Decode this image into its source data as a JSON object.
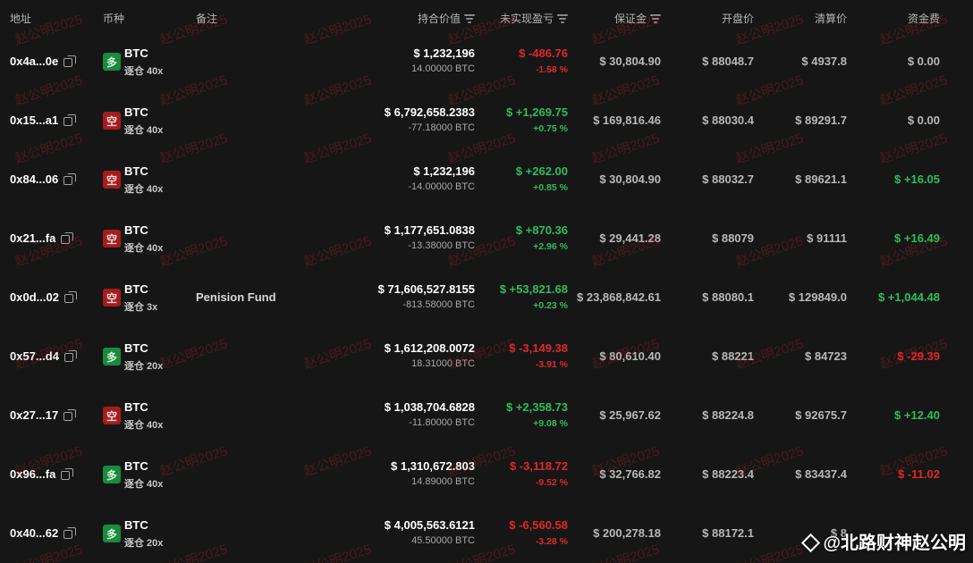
{
  "header": {
    "address": "地址",
    "coin": "币种",
    "note": "备注",
    "position_value": "持合价值",
    "unrealized_pnl": "未实现盈亏",
    "margin": "保证金",
    "entry_price": "开盘价",
    "liquidation_price": "清算价",
    "funding_fee": "资金费"
  },
  "colors": {
    "long": "#1a8a3c",
    "short": "#a51c1c",
    "positive": "#2ebd5a",
    "negative": "#e02828"
  },
  "rows": [
    {
      "address": "0x4a...0e",
      "side": "多",
      "side_type": "long",
      "coin": "BTC",
      "leverage": "逐仓 40x",
      "note": "",
      "position_value": "$ 1,232,196",
      "position_size": "14.00000 BTC",
      "pnl": "$ -486.76",
      "pnl_pct": "-1.58 %",
      "pnl_sign": "neg",
      "margin": "$ 30,804.90",
      "entry": "$ 88048.7",
      "liq": "$ 4937.8",
      "funding": "$ 0.00",
      "funding_sign": "neutral"
    },
    {
      "address": "0x15...a1",
      "side": "空",
      "side_type": "short",
      "coin": "BTC",
      "leverage": "逐仓 40x",
      "note": "",
      "position_value": "$ 6,792,658.2383",
      "position_size": "-77.18000 BTC",
      "pnl": "$ +1,269.75",
      "pnl_pct": "+0.75 %",
      "pnl_sign": "pos",
      "margin": "$ 169,816.46",
      "entry": "$ 88030.4",
      "liq": "$ 89291.7",
      "funding": "$ 0.00",
      "funding_sign": "neutral"
    },
    {
      "address": "0x84...06",
      "side": "空",
      "side_type": "short",
      "coin": "BTC",
      "leverage": "逐仓 40x",
      "note": "",
      "position_value": "$ 1,232,196",
      "position_size": "-14.00000 BTC",
      "pnl": "$ +262.00",
      "pnl_pct": "+0.85 %",
      "pnl_sign": "pos",
      "margin": "$ 30,804.90",
      "entry": "$ 88032.7",
      "liq": "$ 89621.1",
      "funding": "$ +16.05",
      "funding_sign": "pos"
    },
    {
      "address": "0x21...fa",
      "side": "空",
      "side_type": "short",
      "coin": "BTC",
      "leverage": "逐仓 40x",
      "note": "",
      "position_value": "$ 1,177,651.0838",
      "position_size": "-13.38000 BTC",
      "pnl": "$ +870.36",
      "pnl_pct": "+2.96 %",
      "pnl_sign": "pos",
      "margin": "$ 29,441.28",
      "entry": "$ 88079",
      "liq": "$ 91111",
      "funding": "$ +16.49",
      "funding_sign": "pos"
    },
    {
      "address": "0x0d...02",
      "side": "空",
      "side_type": "short",
      "coin": "BTC",
      "leverage": "逐仓 3x",
      "note": "Penision Fund",
      "position_value": "$ 71,606,527.8155",
      "position_size": "-813.58000 BTC",
      "pnl": "$ +53,821.68",
      "pnl_pct": "+0.23 %",
      "pnl_sign": "pos",
      "margin": "$ 23,868,842.61",
      "entry": "$ 88080.1",
      "liq": "$ 129849.0",
      "funding": "$ +1,044.48",
      "funding_sign": "pos"
    },
    {
      "address": "0x57...d4",
      "side": "多",
      "side_type": "long",
      "coin": "BTC",
      "leverage": "逐仓 20x",
      "note": "",
      "position_value": "$ 1,612,208.0072",
      "position_size": "18.31000 BTC",
      "pnl": "$ -3,149.38",
      "pnl_pct": "-3.91 %",
      "pnl_sign": "neg",
      "margin": "$ 80,610.40",
      "entry": "$ 88221",
      "liq": "$ 84723",
      "funding": "$ -29.39",
      "funding_sign": "neg"
    },
    {
      "address": "0x27...17",
      "side": "空",
      "side_type": "short",
      "coin": "BTC",
      "leverage": "逐仓 40x",
      "note": "",
      "position_value": "$ 1,038,704.6828",
      "position_size": "-11.80000 BTC",
      "pnl": "$ +2,358.73",
      "pnl_pct": "+9.08 %",
      "pnl_sign": "pos",
      "margin": "$ 25,967.62",
      "entry": "$ 88224.8",
      "liq": "$ 92675.7",
      "funding": "$ +12.40",
      "funding_sign": "pos"
    },
    {
      "address": "0x96...fa",
      "side": "多",
      "side_type": "long",
      "coin": "BTC",
      "leverage": "逐仓 40x",
      "note": "",
      "position_value": "$ 1,310,672.803",
      "position_size": "14.89000 BTC",
      "pnl": "$ -3,118.72",
      "pnl_pct": "-9.52 %",
      "pnl_sign": "neg",
      "margin": "$ 32,766.82",
      "entry": "$ 88223.4",
      "liq": "$ 83437.4",
      "funding": "$ -11.02",
      "funding_sign": "neg"
    },
    {
      "address": "0x40...62",
      "side": "多",
      "side_type": "long",
      "coin": "BTC",
      "leverage": "逐仓 20x",
      "note": "",
      "position_value": "$ 4,005,563.6121",
      "position_size": "45.50000 BTC",
      "pnl": "$ -6,560.58",
      "pnl_pct": "-3.28 %",
      "pnl_sign": "neg",
      "margin": "$ 200,278.18",
      "entry": "$ 88172.1",
      "liq": "$ 8",
      "funding": "",
      "funding_sign": "neg"
    }
  ],
  "watermark_text": "赵公明2025",
  "signature": "@北路财神赵公明"
}
